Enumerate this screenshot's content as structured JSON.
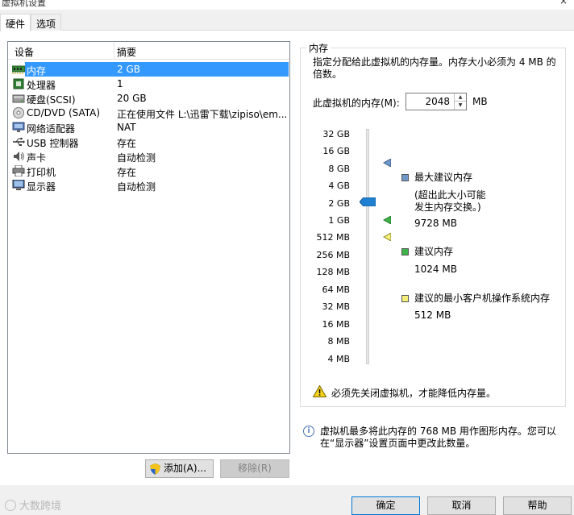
{
  "window": {
    "title": "虚拟机设置",
    "close_glyph": "×"
  },
  "tabs": [
    {
      "label": "硬件",
      "active": true
    },
    {
      "label": "选项",
      "active": false
    }
  ],
  "device_list": {
    "columns": [
      "设备",
      "摘要"
    ],
    "rows": [
      {
        "name": "内存",
        "summary": "2 GB",
        "icon": "memory-icon",
        "selected": true
      },
      {
        "name": "处理器",
        "summary": "1",
        "icon": "processor-icon"
      },
      {
        "name": "硬盘(SCSI)",
        "summary": "20 GB",
        "icon": "hard-disk-icon"
      },
      {
        "name": "CD/DVD (SATA)",
        "summary": "正在使用文件 L:\\迅雷下载\\zipiso\\em...",
        "icon": "cd-dvd-icon"
      },
      {
        "name": "网络适配器",
        "summary": "NAT",
        "icon": "network-adapter-icon"
      },
      {
        "name": "USB 控制器",
        "summary": "存在",
        "icon": "usb-icon"
      },
      {
        "name": "声卡",
        "summary": "自动检测",
        "icon": "sound-card-icon"
      },
      {
        "name": "打印机",
        "summary": "存在",
        "icon": "printer-icon"
      },
      {
        "name": "显示器",
        "summary": "自动检测",
        "icon": "monitor-icon"
      }
    ]
  },
  "buttons": {
    "add": "添加(A)...",
    "remove": "移除(R)",
    "ok": "确定",
    "cancel": "取消",
    "help": "帮助"
  },
  "memory": {
    "group_title": "内存",
    "description": "指定分配给此虚拟机的内存量。内存大小必须为 4 MB 的倍数。",
    "field_label": "此虚拟机的内存(M):",
    "value": "2048",
    "unit": "MB",
    "scale_ticks": [
      "32 GB",
      "16 GB",
      "8 GB",
      "4 GB",
      "2 GB",
      "1 GB",
      "512 MB",
      "256 MB",
      "128 MB",
      "64 MB",
      "32 MB",
      "16 MB",
      "8 MB",
      "4 MB"
    ],
    "current_tick": "2 GB",
    "legend": {
      "max_title": "最大建议内存",
      "max_note_1": "(超出此大小可能",
      "max_note_2": "发生内存交换。)",
      "max_value": "9728 MB",
      "rec_title": "建议内存",
      "rec_value": "1024 MB",
      "min_title": "建议的最小客户机操作系统内存",
      "min_value": "512 MB"
    },
    "colors": {
      "max": "#6f97c9",
      "recommended": "#3fb34a",
      "minimum": "#f3ee7a",
      "thumb": "#1f7fd0"
    },
    "warning": "必须先关闭虚拟机，才能降低内存量。",
    "info": "虚拟机最多将此内存的 768 MB 用作图形内存。您可以在“显示器”设置页面中更改此数量。"
  },
  "watermark": "大数跨境"
}
